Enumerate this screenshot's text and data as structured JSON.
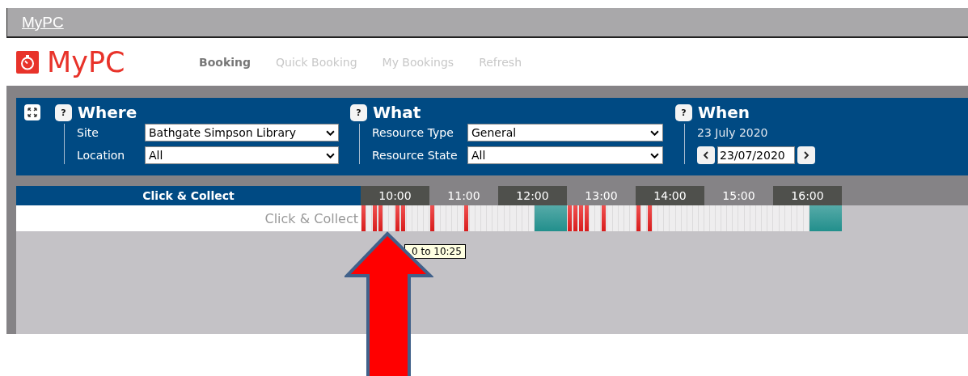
{
  "top_bar": {
    "link": "MyPC"
  },
  "header": {
    "logo": "MyPC",
    "nav": [
      {
        "label": "Booking",
        "selected": true
      },
      {
        "label": "Quick Booking",
        "selected": false
      },
      {
        "label": "My Bookings",
        "selected": false
      },
      {
        "label": "Refresh",
        "selected": false
      }
    ]
  },
  "filters": {
    "where": {
      "help": "?",
      "title": "Where",
      "fields": [
        {
          "label": "Site",
          "value": "Bathgate Simpson Library"
        },
        {
          "label": "Location",
          "value": "All"
        }
      ]
    },
    "what": {
      "help": "?",
      "title": "What",
      "fields": [
        {
          "label": "Resource Type",
          "value": "General"
        },
        {
          "label": "Resource State",
          "value": "All"
        }
      ]
    },
    "when": {
      "help": "?",
      "title": "When",
      "date_text": "23 July 2020",
      "date_value": "23/07/2020"
    }
  },
  "timeline": {
    "title": "Click & Collect",
    "hours": [
      "10:00",
      "11:00",
      "12:00",
      "13:00",
      "14:00",
      "15:00",
      "16:00"
    ],
    "rows": [
      {
        "name": "Click & Collect",
        "slots": [
          [
            {
              "kind": "booked"
            },
            {
              "kind": "free"
            },
            {
              "kind": "booked"
            },
            {
              "kind": "booked"
            },
            {
              "kind": "free"
            },
            {
              "kind": "free"
            },
            {
              "kind": "booked"
            },
            {
              "kind": "booked"
            },
            {
              "kind": "free"
            },
            {
              "kind": "free"
            },
            {
              "kind": "free"
            },
            {
              "kind": "free"
            }
          ],
          [
            {
              "kind": "booked"
            },
            {
              "kind": "free"
            },
            {
              "kind": "free"
            },
            {
              "kind": "free"
            },
            {
              "kind": "free"
            },
            {
              "kind": "free"
            },
            {
              "kind": "booked"
            },
            {
              "kind": "free"
            },
            {
              "kind": "free"
            },
            {
              "kind": "free"
            },
            {
              "kind": "free"
            },
            {
              "kind": "free"
            }
          ],
          [
            {
              "kind": "free"
            },
            {
              "kind": "free"
            },
            {
              "kind": "free"
            },
            {
              "kind": "free"
            },
            {
              "kind": "free"
            },
            {
              "kind": "free"
            },
            {
              "kind": "reserved"
            },
            {
              "kind": "reserved"
            },
            {
              "kind": "reserved"
            },
            {
              "kind": "reserved"
            },
            {
              "kind": "reserved"
            },
            {
              "kind": "reserved"
            }
          ],
          [
            {
              "kind": "booked"
            },
            {
              "kind": "booked"
            },
            {
              "kind": "booked"
            },
            {
              "kind": "booked"
            },
            {
              "kind": "free"
            },
            {
              "kind": "free"
            },
            {
              "kind": "booked"
            },
            {
              "kind": "free"
            },
            {
              "kind": "free"
            },
            {
              "kind": "free"
            },
            {
              "kind": "free"
            },
            {
              "kind": "free"
            }
          ],
          [
            {
              "kind": "booked"
            },
            {
              "kind": "free"
            },
            {
              "kind": "booked"
            },
            {
              "kind": "free"
            },
            {
              "kind": "free"
            },
            {
              "kind": "free"
            },
            {
              "kind": "free"
            },
            {
              "kind": "free"
            },
            {
              "kind": "free"
            },
            {
              "kind": "free"
            },
            {
              "kind": "free"
            },
            {
              "kind": "free"
            }
          ],
          [
            {
              "kind": "free"
            },
            {
              "kind": "free"
            },
            {
              "kind": "free"
            },
            {
              "kind": "free"
            },
            {
              "kind": "free"
            },
            {
              "kind": "free"
            },
            {
              "kind": "free"
            },
            {
              "kind": "free"
            },
            {
              "kind": "free"
            },
            {
              "kind": "free"
            },
            {
              "kind": "free"
            },
            {
              "kind": "free"
            }
          ],
          [
            {
              "kind": "free"
            },
            {
              "kind": "free"
            },
            {
              "kind": "free"
            },
            {
              "kind": "free"
            },
            {
              "kind": "free"
            },
            {
              "kind": "free"
            },
            {
              "kind": "reserved"
            },
            {
              "kind": "reserved"
            },
            {
              "kind": "reserved"
            },
            {
              "kind": "reserved"
            },
            {
              "kind": "reserved"
            },
            {
              "kind": "reserved"
            }
          ]
        ]
      }
    ],
    "tooltip": "0 to 10:25"
  }
}
